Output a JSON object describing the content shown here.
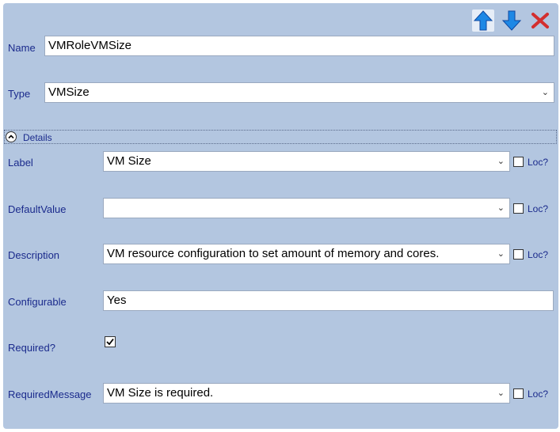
{
  "toolbar": {
    "move_up_icon": "arrow-up-icon",
    "move_down_icon": "arrow-down-icon",
    "delete_icon": "close-icon"
  },
  "name": {
    "label": "Name",
    "value": "VMRoleVMSize"
  },
  "type": {
    "label": "Type",
    "value": "VMSize"
  },
  "details": {
    "label": "Details"
  },
  "fields": {
    "label": {
      "label": "Label",
      "value": "VM Size",
      "loc": "Loc?"
    },
    "default_value": {
      "label": "DefaultValue",
      "value": "",
      "loc": "Loc?"
    },
    "description": {
      "label": "Description",
      "value": "VM resource configuration to set amount of memory and cores.",
      "loc": "Loc?"
    },
    "configurable": {
      "label": "Configurable",
      "value": "Yes"
    },
    "required": {
      "label": "Required?",
      "checked": true
    },
    "required_message": {
      "label": "RequiredMessage",
      "value": "VM Size is required.",
      "loc": "Loc?"
    }
  },
  "colors": {
    "panel": "#b3c6e0",
    "label": "#1a2a8c",
    "arrow": "#1e88e5",
    "delete": "#d32f2f"
  }
}
